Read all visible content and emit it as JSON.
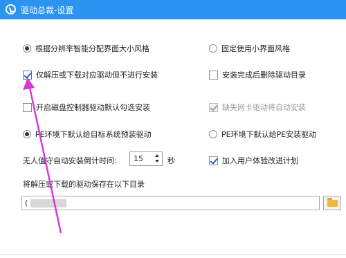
{
  "window": {
    "title": "驱动总裁-设置"
  },
  "options": {
    "auto_scale": "根据分辨率智能分配界面大小风格",
    "fixed_small": "固定使用小界面风格",
    "only_extract": "仅解压或下载对应驱动但不进行安装",
    "delete_after": "安装完成后删除驱动目录",
    "disk_controller": "开启磁盘控制器驱动默认勾选安装",
    "missing_nic": "缺失网卡驱动将自动安装",
    "pe_target": "PE环境下默认给目标系统预装驱动",
    "pe_install": "PE环境下默认给PE安装驱动",
    "countdown_label": "无人值守自动安装倒计时间:",
    "countdown_value": "15",
    "seconds_unit": "秒",
    "ux_plan": "加入用户体验改进计划",
    "save_dir_label": "将解压或下载的驱动保存在以下目录",
    "save_dir_value": "("
  },
  "states": {
    "auto_scale": true,
    "fixed_small": false,
    "only_extract": true,
    "delete_after": false,
    "disk_controller": false,
    "missing_nic": true,
    "pe_target": true,
    "pe_install": false,
    "ux_plan": true
  },
  "colors": {
    "titlebar": "#2b93f0",
    "annotation_arrow": "#d63ad6"
  },
  "icons": {
    "app": "steering-wheel-icon",
    "folder": "folder-icon"
  }
}
